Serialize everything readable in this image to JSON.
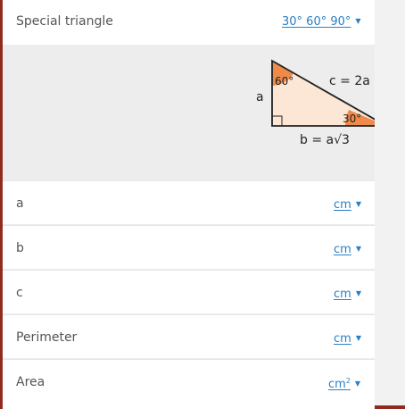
{
  "header": {
    "title": "Special triangle",
    "selected_option": "30° 60° 90°"
  },
  "diagram": {
    "angle_top": "60°",
    "angle_right": "30°",
    "side_a": "a",
    "side_c": "c = 2a",
    "side_b": "b = a√3",
    "colors": {
      "fill": "#fce7d6",
      "angle_fill": "#f08a4b",
      "stroke": "#222222"
    }
  },
  "fields": [
    {
      "label": "a",
      "unit": "cm"
    },
    {
      "label": "b",
      "unit": "cm"
    },
    {
      "label": "c",
      "unit": "cm"
    },
    {
      "label": "Perimeter",
      "unit": "cm"
    },
    {
      "label": "Area",
      "unit": "cm",
      "unit_sup": "2"
    }
  ],
  "colors": {
    "link": "#2b7fc4",
    "accent_border": "#a23221"
  }
}
